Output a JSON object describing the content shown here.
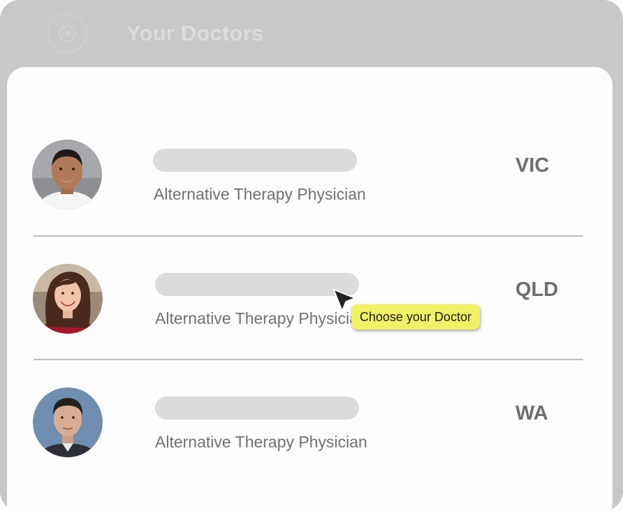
{
  "header": {
    "title": "Your Doctors",
    "back_icon": "arrow-right-circle-icon"
  },
  "doctors": [
    {
      "specialty": "Alternative Therapy Physician",
      "state": "VIC",
      "avatar": "male-doctor-avatar"
    },
    {
      "specialty": "Alternative Therapy Physician",
      "state": "QLD",
      "avatar": "female-doctor-avatar"
    },
    {
      "specialty": "Alternative Therapy Physician",
      "state": "WA",
      "avatar": "male-doctor-avatar"
    }
  ],
  "tooltip": {
    "text": "Choose your Doctor"
  },
  "colors": {
    "frame": "#c8c7c9",
    "panel": "#fdfdfd",
    "tooltip": "#f1f166",
    "name_placeholder": "#dcdbdd"
  }
}
